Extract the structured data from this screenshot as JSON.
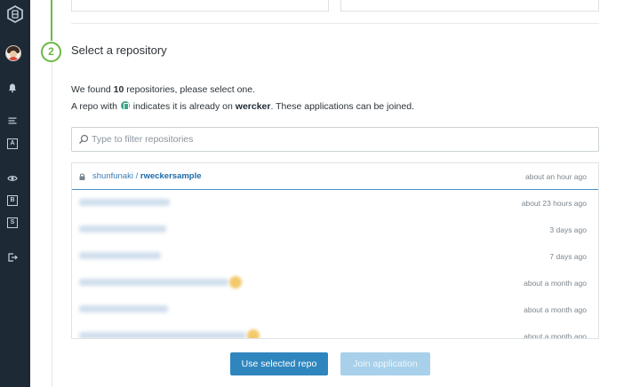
{
  "sidebar": {
    "items": [
      {
        "icon": "wercker-logo-icon"
      },
      {
        "icon": "avatar"
      },
      {
        "icon": "bell-icon"
      },
      {
        "icon": "menu-icon"
      },
      {
        "icon": "badge-a-icon",
        "label": "A"
      },
      {
        "icon": "eye-icon"
      },
      {
        "icon": "badge-b-icon",
        "label": "B"
      },
      {
        "icon": "badge-s-icon",
        "label": "S"
      },
      {
        "icon": "logout-icon"
      }
    ]
  },
  "step": {
    "number": "2",
    "title": "Select a repository"
  },
  "summary": {
    "prefix": "We found ",
    "count": "10",
    "suffix": " repositories, please select one."
  },
  "note": {
    "prefix": "A repo with ",
    "middle": " indicates it is already on ",
    "brand": "wercker",
    "suffix": ". These applications can be joined."
  },
  "filter": {
    "placeholder": "Type to filter repositories",
    "value": ""
  },
  "repositories": [
    {
      "owner": "shunfunaki / ",
      "name": "rweckersample",
      "time": "about an hour ago",
      "selected": true,
      "visible_name": true
    },
    {
      "time": "about 23 hours ago",
      "visible_name": false
    },
    {
      "time": "3 days ago",
      "visible_name": false
    },
    {
      "time": "7 days ago",
      "visible_name": false
    },
    {
      "time": "about a month ago",
      "visible_name": false,
      "already_on_wercker": true
    },
    {
      "time": "about a month ago",
      "visible_name": false
    },
    {
      "time": "about a month ago",
      "visible_name": false,
      "already_on_wercker": true
    }
  ],
  "actions": {
    "use_selected": "Use selected repo",
    "join": "Join application"
  },
  "colors": {
    "sidebar_bg": "#1d2a36",
    "step_green": "#6bb844",
    "primary_button": "#2f86be",
    "disabled_button": "#a8d0ea",
    "link_blue": "#1f6aa5"
  }
}
